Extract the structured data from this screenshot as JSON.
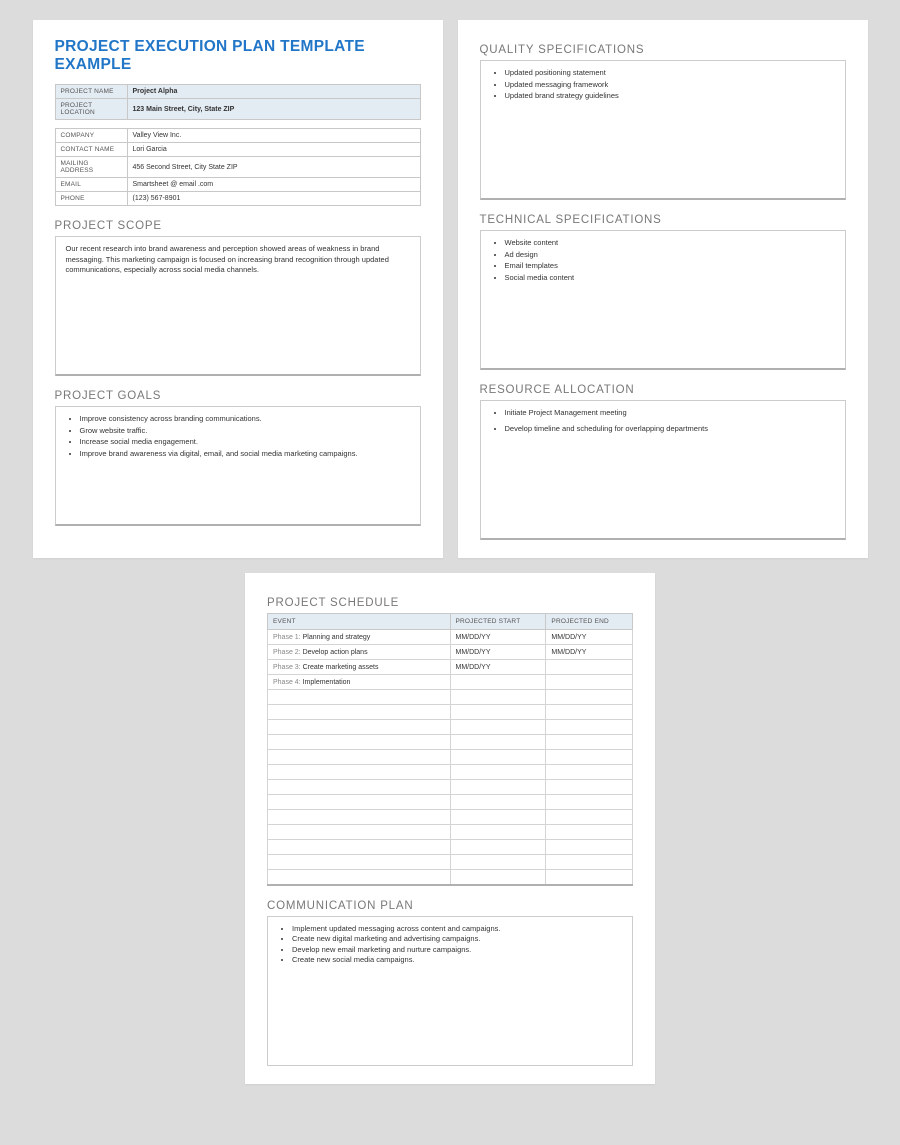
{
  "title": "PROJECT EXECUTION PLAN TEMPLATE EXAMPLE",
  "projHeader": {
    "nameLabel": "PROJECT NAME",
    "nameValue": "Project Alpha",
    "locLabel": "PROJECT LOCATION",
    "locValue": "123 Main Street, City, State ZIP"
  },
  "contact": {
    "companyLabel": "COMPANY",
    "companyValue": "Valley View Inc.",
    "contactLabel": "CONTACT NAME",
    "contactValue": "Lori Garcia",
    "mailLabel": "MAILING ADDRESS",
    "mailValue": "456 Second Street, City State ZIP",
    "emailLabel": "EMAIL",
    "emailValue": "Smartsheet @ email .com",
    "phoneLabel": "PHONE",
    "phoneValue": "(123) 567-8901"
  },
  "sections": {
    "scope": "PROJECT SCOPE",
    "goals": "PROJECT GOALS",
    "quality": "QUALITY SPECIFICATIONS",
    "tech": "TECHNICAL SPECIFICATIONS",
    "resource": "RESOURCE ALLOCATION",
    "schedule": "PROJECT SCHEDULE",
    "comm": "COMMUNICATION PLAN"
  },
  "scopeText": "Our recent research into brand awareness and perception showed areas of weakness in brand messaging. This marketing campaign is focused on increasing brand recognition through updated communications, especially across social media channels.",
  "goals": [
    "Improve consistency across branding communications.",
    "Grow website traffic.",
    "Increase social media engagement.",
    "Improve brand awareness via digital, email, and social media marketing campaigns."
  ],
  "quality": [
    "Updated positioning statement",
    "Updated messaging framework",
    "Updated brand strategy guidelines"
  ],
  "tech": [
    "Website content",
    "Ad design",
    "Email templates",
    "Social media content"
  ],
  "resource": [
    "Initiate Project Management meeting",
    "Develop timeline and scheduling for overlapping departments"
  ],
  "schedHeaders": {
    "event": "EVENT",
    "start": "PROJECTED START",
    "end": "PROJECTED END"
  },
  "schedule": [
    {
      "phase": "Phase 1:",
      "event": "Planning and strategy",
      "start": "MM/DD/YY",
      "end": "MM/DD/YY"
    },
    {
      "phase": "Phase 2:",
      "event": "Develop action plans",
      "start": "MM/DD/YY",
      "end": "MM/DD/YY"
    },
    {
      "phase": "Phase 3:",
      "event": "Create marketing assets",
      "start": "MM/DD/YY",
      "end": ""
    },
    {
      "phase": "Phase 4:",
      "event": "Implementation",
      "start": "",
      "end": ""
    }
  ],
  "comm": [
    "Implement updated messaging across content and campaigns.",
    "Create new digital marketing and advertising campaigns.",
    "Develop new email marketing and nurture campaigns.",
    "Create new social media campaigns."
  ]
}
